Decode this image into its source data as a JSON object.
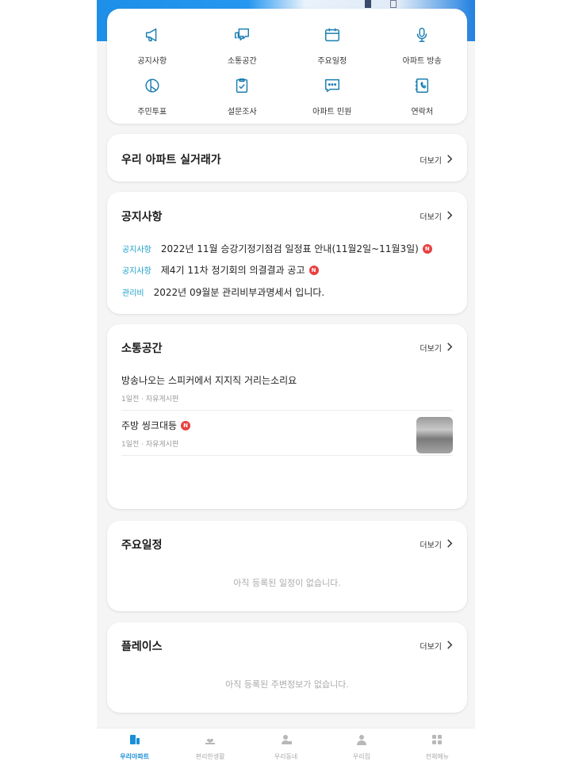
{
  "colors": {
    "accent": "#1a8fd8",
    "notice_tag": "#1aa0c8",
    "badge_new": "#e84040",
    "icon": "#1a7fb0"
  },
  "menu": {
    "items": [
      {
        "label": "공지사항",
        "icon": "megaphone-icon"
      },
      {
        "label": "소통공간",
        "icon": "chat-bubbles-icon"
      },
      {
        "label": "주요일정",
        "icon": "calendar-icon"
      },
      {
        "label": "아파트 방송",
        "icon": "microphone-icon"
      },
      {
        "label": "주민투표",
        "icon": "vote-icon"
      },
      {
        "label": "설문조사",
        "icon": "clipboard-check-icon"
      },
      {
        "label": "아파트 민원",
        "icon": "message-dots-icon"
      },
      {
        "label": "연락처",
        "icon": "phone-book-icon"
      }
    ]
  },
  "more_label": "더보기",
  "transactions": {
    "title": "우리 아파트 실거래가"
  },
  "notices": {
    "title": "공지사항",
    "items": [
      {
        "tag": "공지사항",
        "text": "2022년 11월 승강기정기점검 일정표 안내(11월2일~11월3일)",
        "is_new": true
      },
      {
        "tag": "공지사항",
        "text": "제4기 11차 정기회의 의결결과 공고",
        "is_new": true
      },
      {
        "tag": "관리비",
        "text": "2022년 09월분 관리비부과명세서 입니다.",
        "is_new": false
      }
    ]
  },
  "badge_new_label": "N",
  "community": {
    "title": "소통공간",
    "posts": [
      {
        "title": "방송나오는 스피커에서 지지직 거리는소리요",
        "meta": "1일전 · 자유게시판",
        "is_new": false,
        "has_thumbnail": false
      },
      {
        "title": "주방 씽크대등",
        "meta": "1일전 · 자유게시판",
        "is_new": true,
        "has_thumbnail": true
      }
    ]
  },
  "schedule": {
    "title": "주요일정",
    "empty_text": "아직 등록된 일정이 없습니다."
  },
  "places": {
    "title": "플레이스",
    "empty_text": "아직 등록된 주변정보가 없습니다."
  },
  "tabbar": {
    "tabs": [
      {
        "label": "우리아파트",
        "icon": "apartment-icon",
        "active": true
      },
      {
        "label": "편리한생활",
        "icon": "hand-heart-icon",
        "active": false
      },
      {
        "label": "우리동네",
        "icon": "neighborhood-icon",
        "active": false
      },
      {
        "label": "우리집",
        "icon": "person-icon",
        "active": false
      },
      {
        "label": "전체메뉴",
        "icon": "grid-menu-icon",
        "active": false
      }
    ]
  }
}
